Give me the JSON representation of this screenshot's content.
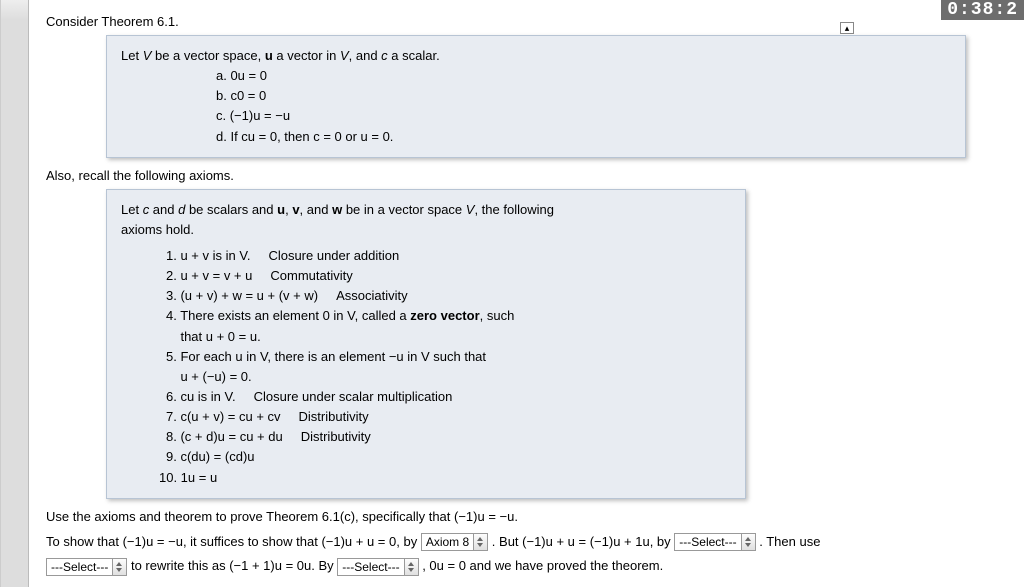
{
  "timer": "0:38:2",
  "instr1": "Consider Theorem 6.1.",
  "theorem": {
    "intro_before_V": "Let ",
    "intro_text": " be a vector space, ",
    "intro_mid": " a vector in ",
    "intro_end": ", and ",
    "intro_scalar": " a scalar.",
    "a": "a. 0u = 0",
    "b": "b. c0 = 0",
    "c": "c. (−1)u = −u",
    "d": "d. If cu = 0, then c = 0 or u = 0."
  },
  "instr2": "Also, recall the following axioms.",
  "axioms": {
    "intro1": "Let ",
    "intro2": " and ",
    "intro3": " be scalars and ",
    "intro4": ", and ",
    "intro5": " be in a vector space ",
    "intro6": ", the following",
    "intro_line2": "axioms hold.",
    "rows": {
      "1a": "1.  u + v is in V.",
      "1b": "Closure under addition",
      "2a": "2.  u + v = v + u",
      "2b": "Commutativity",
      "3a": "3.  (u + v) + w = u + (v + w)",
      "3b": "Associativity",
      "4a": "4.  There exists an element 0 in V, called a ",
      "4b": "zero vector",
      "4c": ", such",
      "4d": "that u + 0 = u.",
      "5a": "5.  For each u in V, there is an element −u in V such that",
      "5b": "u + (−u) = 0.",
      "6a": "6.  cu is in V.",
      "6b": "Closure under scalar multiplication",
      "7a": "7.  c(u + v) = cu + cv",
      "7b": "Distributivity",
      "8a": "8.  (c + d)u = cu + du",
      "8b": "Distributivity",
      "9a": "9.  c(du) = (cd)u",
      "10a": "10.  1u = u"
    }
  },
  "instr3": "Use the axioms and theorem to prove Theorem 6.1(c), specifically that (−1)u = −u.",
  "proof": {
    "p1": "To show that (−1)u = −u, it suffices to show that (−1)u + u = 0, by ",
    "sel1": "Axiom 8",
    "p2": " . But (−1)u + u = (−1)u + 1u, by ",
    "sel2": "---Select---",
    "p3": " . Then use",
    "sel3": "---Select---",
    "p4": " to rewrite this as (−1 + 1)u = 0u. By ",
    "sel4": "---Select---",
    "p5": " , 0u = 0 and we have proved the theorem."
  }
}
